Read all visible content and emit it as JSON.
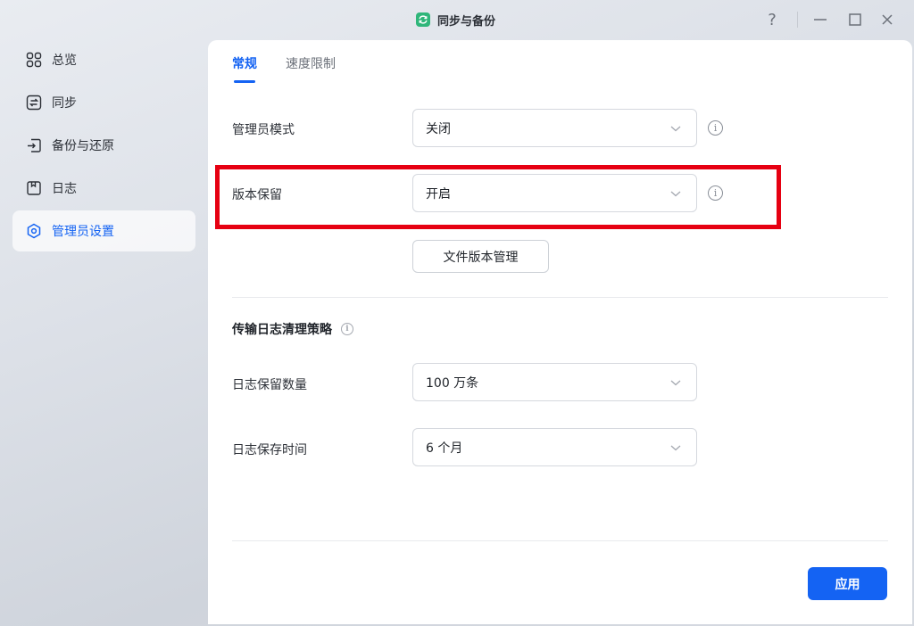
{
  "app": {
    "title": "同步与备份"
  },
  "window_controls": {
    "help": "?",
    "minimize": "—",
    "maximize": "☐",
    "close": "✕"
  },
  "sidebar": {
    "items": [
      {
        "label": "总览",
        "icon": "grid-icon",
        "active": false
      },
      {
        "label": "同步",
        "icon": "sync-icon",
        "active": false
      },
      {
        "label": "备份与还原",
        "icon": "backup-icon",
        "active": false
      },
      {
        "label": "日志",
        "icon": "log-icon",
        "active": false
      },
      {
        "label": "管理员设置",
        "icon": "admin-settings-icon",
        "active": true
      }
    ]
  },
  "tabs": [
    {
      "label": "常规",
      "active": true
    },
    {
      "label": "速度限制",
      "active": false
    }
  ],
  "settings": {
    "admin_mode": {
      "label": "管理员模式",
      "value": "关闭"
    },
    "version_keep": {
      "label": "版本保留",
      "value": "开启"
    },
    "file_version_button": "文件版本管理",
    "log_section_title": "传输日志清理策略",
    "log_count": {
      "label": "日志保留数量",
      "value": "100 万条"
    },
    "log_time": {
      "label": "日志保存时间",
      "value": "6 个月"
    }
  },
  "apply_button": "应用",
  "colors": {
    "accent": "#1463f3",
    "highlight": "#e60012",
    "logo": "#2fb67a"
  }
}
